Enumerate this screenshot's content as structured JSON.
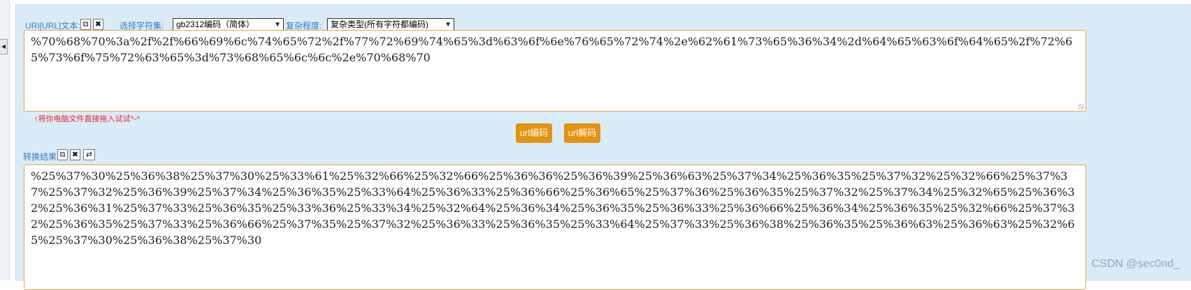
{
  "input_section": {
    "label": "URI[URL]文本:",
    "copy_icon": "copy-icon",
    "clear_icon": "close-icon"
  },
  "charset": {
    "label": "选择字符集:",
    "selected": "gb2312编码（简体）"
  },
  "complexity": {
    "label": "复杂程度:",
    "selected": "复杂类型(所有字符都编码)"
  },
  "input_text": "%70%68%70%3a%2f%2f%66%69%6c%74%65%72%2f%77%72%69%74%65%3d%63%6f%6e%76%65%72%74%2e%62%61%73%65%36%34%2d%64%65%63%6f%64%65%2f%72%65%73%6f%75%72%63%65%3d%73%68%65%6c%6c%2e%70%68%70",
  "drag_hint": "↑将你电脑文件直接拖入试试^-^",
  "buttons": {
    "encode": "url编码",
    "decode": "url解码"
  },
  "result_section": {
    "label": "转换结果:",
    "copy_icon": "copy-icon",
    "clear_icon": "close-icon",
    "swap_icon": "swap-icon"
  },
  "result_text": "%25%37%30%25%36%38%25%37%30%25%33%61%25%32%66%25%32%66%25%36%36%25%36%39%25%36%63%25%37%34%25%36%35%25%37%32%25%32%66%25%37%37%25%37%32%25%36%39%25%37%34%25%36%35%25%33%64%25%36%33%25%36%66%25%36%65%25%37%36%25%36%35%25%37%32%25%37%34%25%32%65%25%36%32%25%36%31%25%37%33%25%36%35%25%33%36%25%33%34%25%32%64%25%36%34%25%36%35%25%36%33%25%36%66%25%36%34%25%36%35%25%32%66%25%37%32%25%36%35%25%37%33%25%36%66%25%37%35%25%37%32%25%36%33%25%36%35%25%33%64%25%37%33%25%36%38%25%36%35%25%36%63%25%36%63%25%32%65%25%37%30%25%36%38%25%37%30",
  "watermark": "CSDN @sec0nd_",
  "colors": {
    "panel_bg": "#daebf8",
    "label_blue": "#3a7cc0",
    "button_orange": "#e3930f",
    "textbox_border": "#e0a84a",
    "hint_red": "#e8262b"
  }
}
